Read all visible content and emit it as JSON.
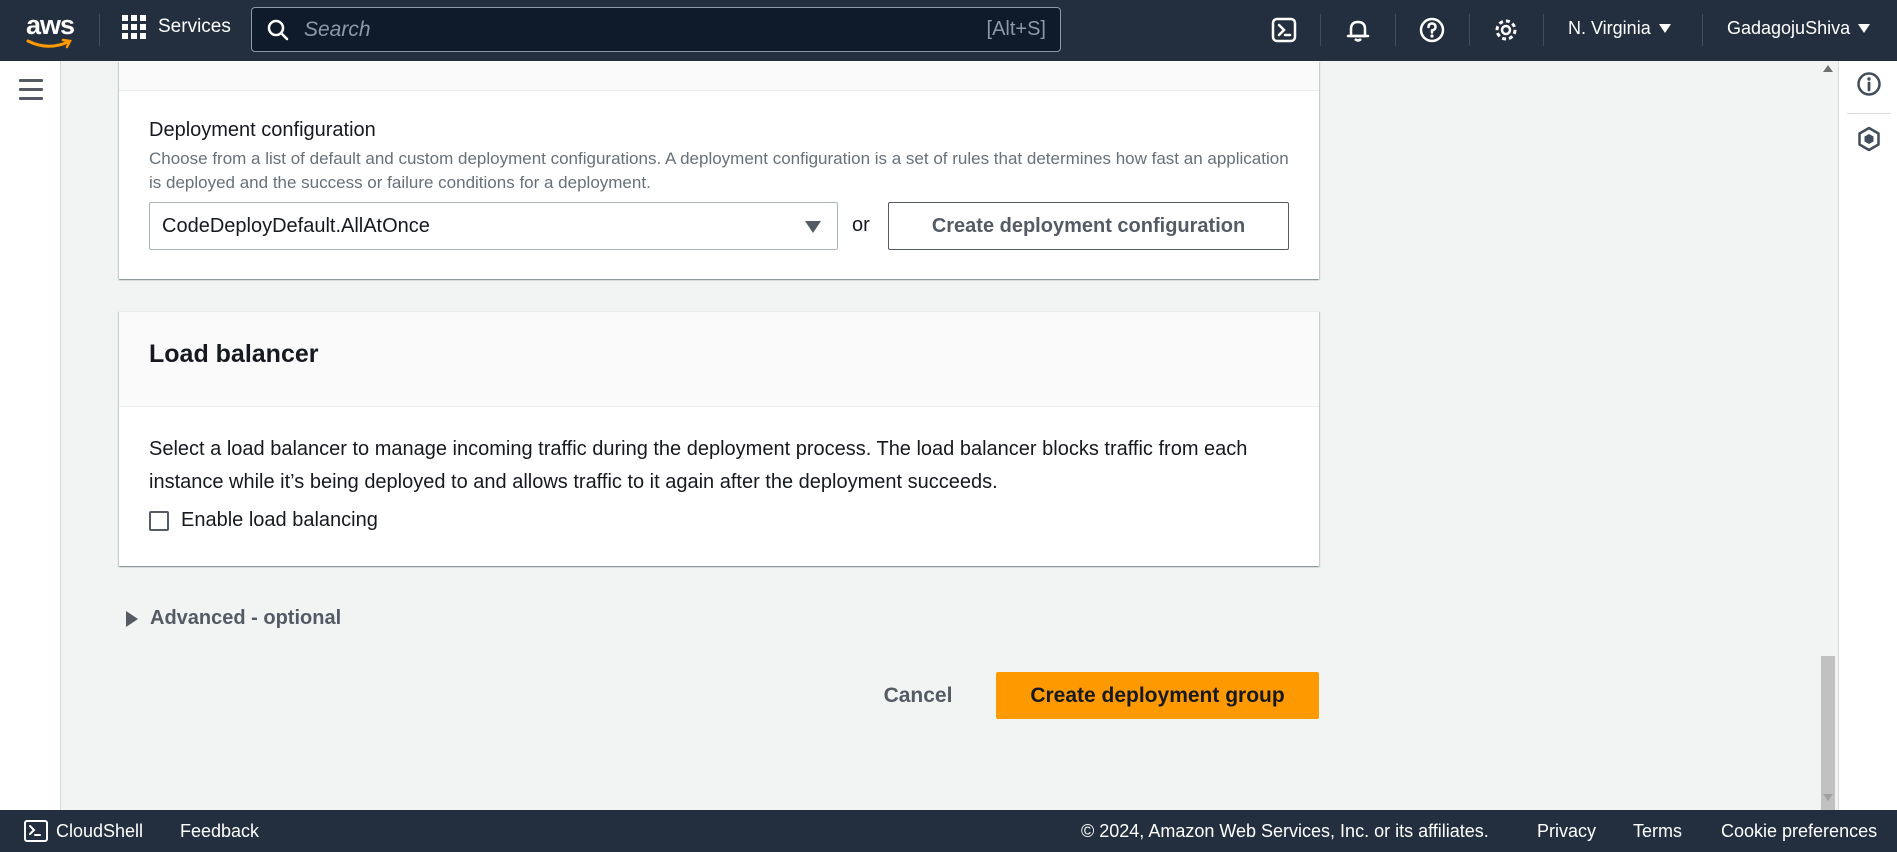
{
  "nav": {
    "logo_text": "aws",
    "services_label": "Services",
    "search_placeholder": "Search",
    "search_shortcut": "[Alt+S]",
    "region": "N. Virginia",
    "account": "GadagojuShiva"
  },
  "deployment_configuration": {
    "label": "Deployment configuration",
    "description": "Choose from a list of default and custom deployment configurations. A deployment configuration is a set of rules that determines how fast an application is deployed and the success or failure conditions for a deployment.",
    "selected_value": "CodeDeployDefault.AllAtOnce",
    "or_text": "or",
    "create_button": "Create deployment configuration"
  },
  "load_balancer": {
    "title": "Load balancer",
    "description": "Select a load balancer to manage incoming traffic during the deployment process. The load balancer blocks traffic from each instance while it’s being deployed to and allows traffic to it again after the deployment succeeds.",
    "checkbox_label": "Enable load balancing",
    "checked": false
  },
  "advanced": {
    "label": "Advanced - optional"
  },
  "actions": {
    "cancel": "Cancel",
    "primary": "Create deployment group"
  },
  "footer": {
    "cloudshell": "CloudShell",
    "feedback": "Feedback",
    "copyright": "© 2024, Amazon Web Services, Inc. or its affiliates.",
    "privacy": "Privacy",
    "terms": "Terms",
    "cookies": "Cookie preferences"
  },
  "colors": {
    "nav_bg": "#232f3e",
    "primary_button": "#ff9900",
    "page_bg": "#f2f3f3"
  }
}
